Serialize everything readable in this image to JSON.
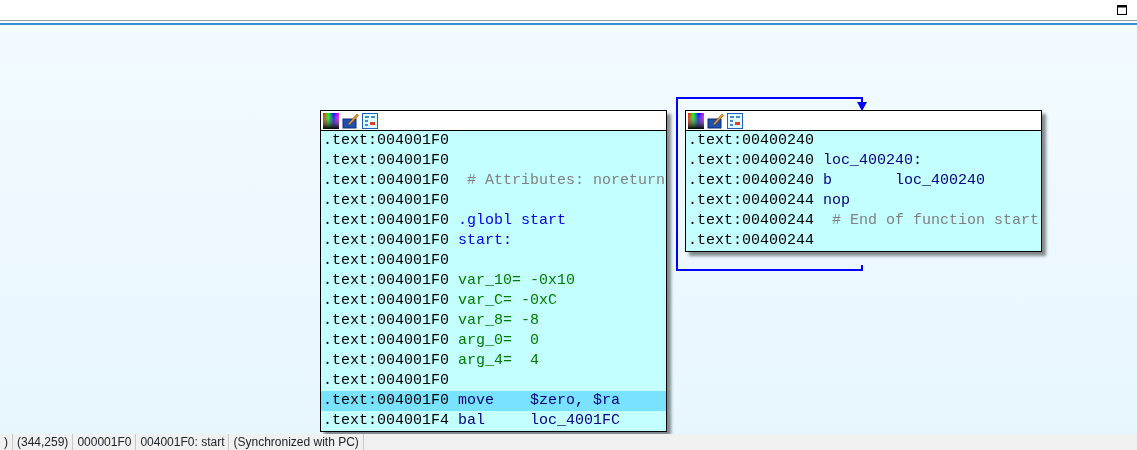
{
  "nodes": [
    {
      "lines": [
        {
          "address": ".text:004001F0",
          "kind": "plain",
          "selected": false
        },
        {
          "address": ".text:004001F0",
          "kind": "plain",
          "selected": false
        },
        {
          "address": ".text:004001F0",
          "kind": "comment",
          "text": " # Attributes: noreturn",
          "selected": false
        },
        {
          "address": ".text:004001F0",
          "kind": "plain",
          "selected": false
        },
        {
          "address": ".text:004001F0",
          "kind": "directive",
          "text": ".globl start",
          "selected": false
        },
        {
          "address": ".text:004001F0",
          "kind": "directive",
          "text": "start:",
          "selected": false
        },
        {
          "address": ".text:004001F0",
          "kind": "plain",
          "selected": false
        },
        {
          "address": ".text:004001F0",
          "kind": "var",
          "text": "var_10= -0x10",
          "selected": false
        },
        {
          "address": ".text:004001F0",
          "kind": "var",
          "text": "var_C= -0xC",
          "selected": false
        },
        {
          "address": ".text:004001F0",
          "kind": "var",
          "text": "var_8= -8",
          "selected": false
        },
        {
          "address": ".text:004001F0",
          "kind": "var",
          "text": "arg_0=  0",
          "selected": false
        },
        {
          "address": ".text:004001F0",
          "kind": "var",
          "text": "arg_4=  4",
          "selected": false
        },
        {
          "address": ".text:004001F0",
          "kind": "plain",
          "selected": false
        },
        {
          "address": ".text:004001F0",
          "kind": "insn",
          "text": "move    $zero, $ra",
          "selected": true
        },
        {
          "address": ".text:004001F4",
          "kind": "insn",
          "text": "bal     loc_4001FC",
          "selected": false
        }
      ]
    },
    {
      "lines": [
        {
          "address": ".text:00400240",
          "kind": "plain",
          "selected": false
        },
        {
          "address": ".text:00400240",
          "kind": "insn",
          "text": "loc_400240:",
          "selected": false
        },
        {
          "address": ".text:00400240",
          "kind": "insn",
          "text": "b       loc_400240",
          "selected": false
        },
        {
          "address": ".text:00400244",
          "kind": "insn",
          "text": "nop",
          "selected": false
        },
        {
          "address": ".text:00400244",
          "kind": "comment",
          "text": " # End of function start",
          "selected": false
        },
        {
          "address": ".text:00400244",
          "kind": "plain",
          "selected": false
        }
      ]
    }
  ],
  "status_bar": [
    ")",
    "(344,259)",
    "000001F0",
    "004001F0: start",
    "(Synchronized with PC)"
  ]
}
